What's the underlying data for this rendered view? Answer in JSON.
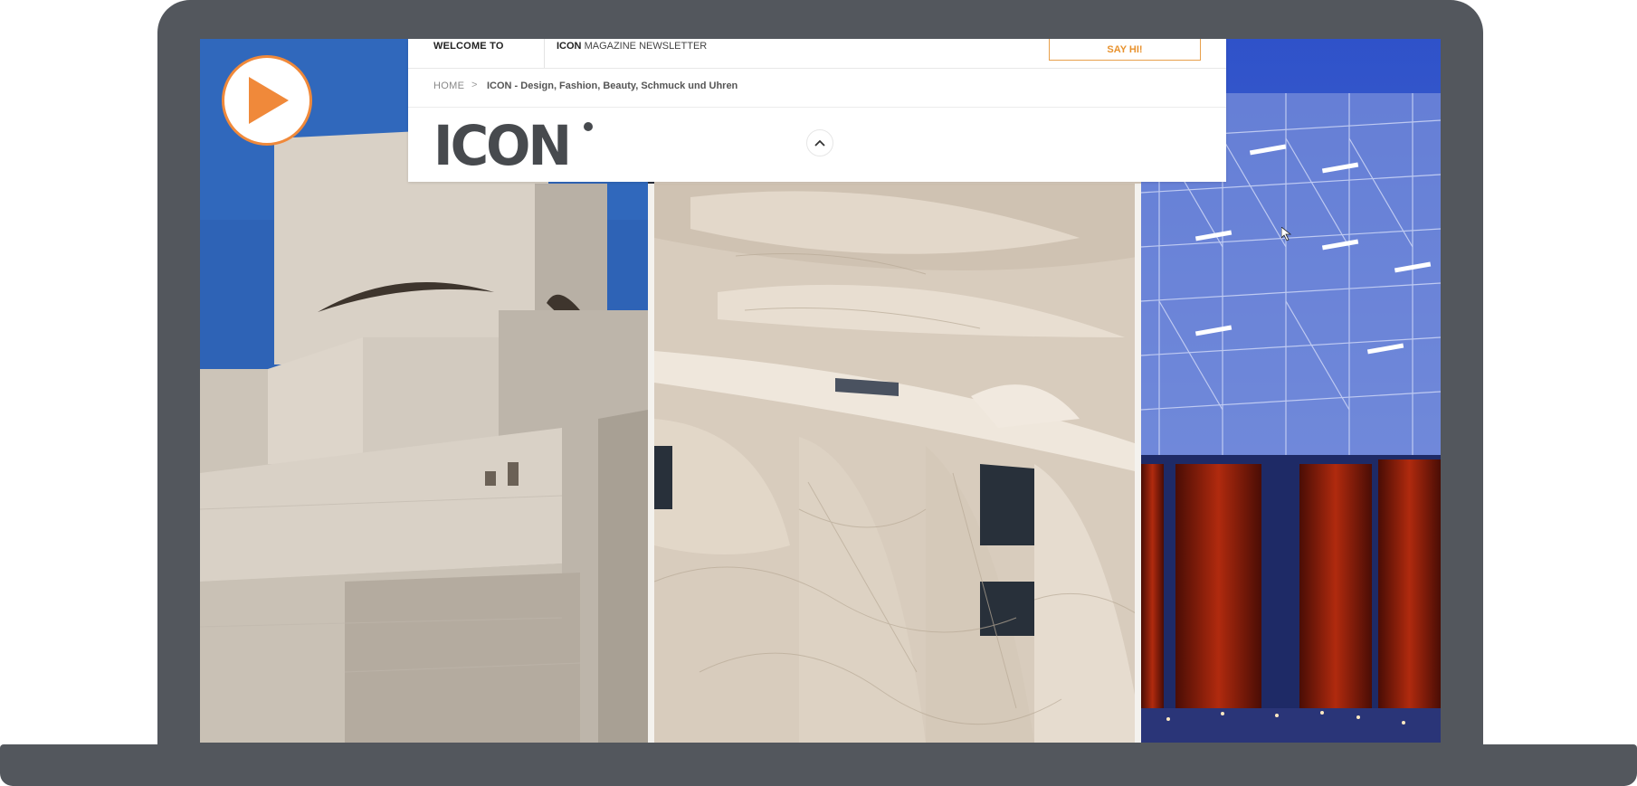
{
  "colors": {
    "device_frame": "#53575d",
    "accent": "#f0893a",
    "header_bg": "#ffffff"
  },
  "top_bar": {
    "welcome_label": "WELCOME TO",
    "brand_label": "ICON",
    "newsletter_label": "MAGAZINE NEWSLETTER",
    "say_hi_label": "SAY HI!"
  },
  "breadcrumb": {
    "home_label": "HOME",
    "separator": ">",
    "current_label": "ICON - Design, Fashion, Beauty, Schmuck und Uhren"
  },
  "logo": {
    "text": "ICON"
  },
  "icons": {
    "collapse": "chevron-up-icon",
    "play": "play-icon",
    "cursor": "mouse-cursor-icon"
  },
  "gallery": {
    "images": [
      {
        "name": "stone-museum-building"
      },
      {
        "name": "desert-rose-facade"
      },
      {
        "name": "scaffold-pavilion-night"
      }
    ]
  }
}
